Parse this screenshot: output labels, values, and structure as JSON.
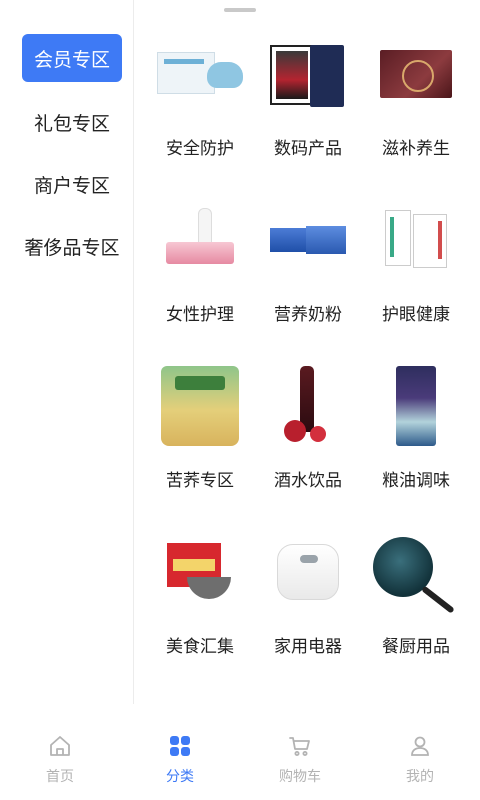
{
  "sidebar": {
    "items": [
      {
        "label": "会员专区",
        "active": true
      },
      {
        "label": "礼包专区",
        "active": false
      },
      {
        "label": "商户专区",
        "active": false
      },
      {
        "label": "奢侈品专区",
        "active": false
      }
    ]
  },
  "grid": {
    "items": [
      {
        "label": "安全防护",
        "icon": "mask-box-image"
      },
      {
        "label": "数码产品",
        "icon": "tablet-image"
      },
      {
        "label": "滋补养生",
        "icon": "gift-box-image"
      },
      {
        "label": "女性护理",
        "icon": "lotion-tube-image"
      },
      {
        "label": "营养奶粉",
        "icon": "milk-powder-image"
      },
      {
        "label": "护眼健康",
        "icon": "eye-care-box-image"
      },
      {
        "label": "苦荞专区",
        "icon": "buckwheat-bag-image"
      },
      {
        "label": "酒水饮品",
        "icon": "wine-bottle-image"
      },
      {
        "label": "粮油调味",
        "icon": "oil-can-image"
      },
      {
        "label": "美食汇集",
        "icon": "rice-box-image"
      },
      {
        "label": "家用电器",
        "icon": "rice-cooker-image"
      },
      {
        "label": "餐厨用品",
        "icon": "wok-pan-image"
      }
    ]
  },
  "tabbar": {
    "tabs": [
      {
        "label": "首页",
        "icon": "home-icon",
        "active": false
      },
      {
        "label": "分类",
        "icon": "category-grid-icon",
        "active": true
      },
      {
        "label": "购物车",
        "icon": "cart-icon",
        "active": false
      },
      {
        "label": "我的",
        "icon": "user-icon",
        "active": false
      }
    ]
  },
  "colors": {
    "accent": "#3e7af5",
    "inactive_tab": "#b3b3b3",
    "text": "#222222"
  }
}
